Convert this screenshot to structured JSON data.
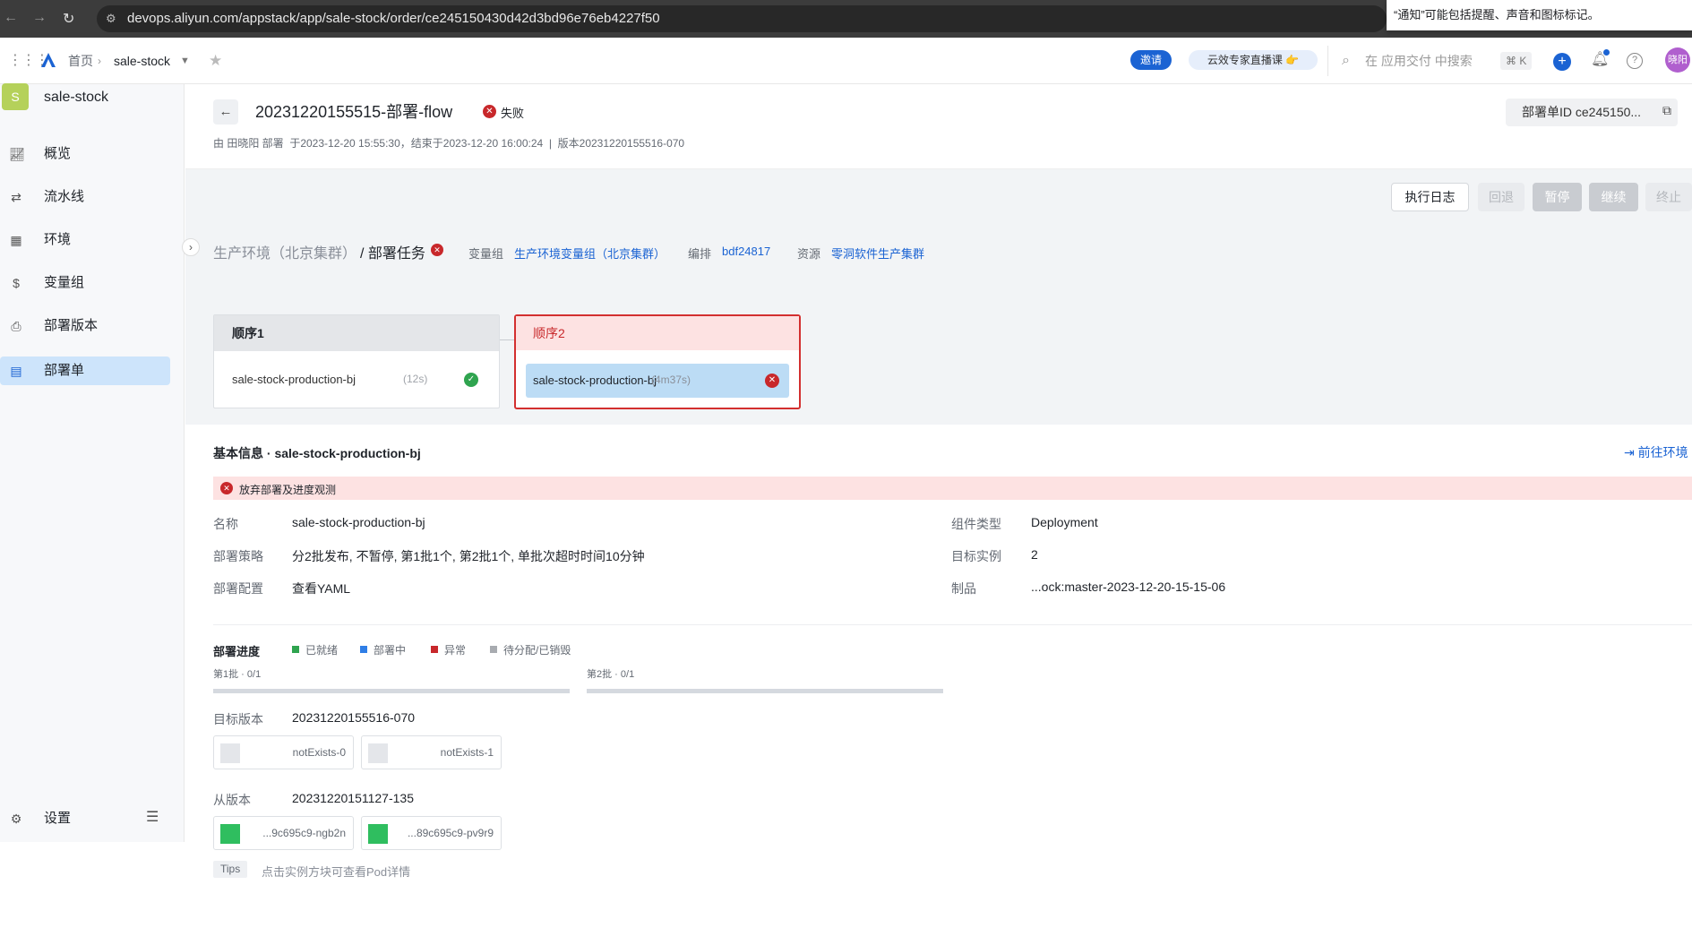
{
  "browser": {
    "url": "devops.aliyun.com/appstack/app/sale-stock/order/ce245150430d42d3bd96e76eb4227f50",
    "notification": "“通知”可能包括提醒、声音和图标标记。"
  },
  "topnav": {
    "home": "首页",
    "app": "sale-stock",
    "invite": "邀请",
    "live": "云效专家直播课 👉",
    "search_placeholder": "在 应用交付 中搜索",
    "shortcut": "⌘ K",
    "avatar": "晓阳"
  },
  "sidebar": {
    "app_initial": "S",
    "app_name": "sale-stock",
    "items": [
      {
        "label": "概览"
      },
      {
        "label": "流水线"
      },
      {
        "label": "环境"
      },
      {
        "label": "变量组"
      },
      {
        "label": "部署版本"
      },
      {
        "label": "部署单"
      }
    ],
    "settings": "设置"
  },
  "header": {
    "title": "20231220155515-部署-flow",
    "status": "失败",
    "meta": "由 田晓阳 部署  于2023-12-20 15:55:30，结束于2023-12-20 16:00:24  |  版本20231220155516-070",
    "order_id": "部署单ID ce245150..."
  },
  "stage": {
    "env": "生产环境（北京集群）",
    "task": "/ 部署任务",
    "var_label": "变量组",
    "var_value": "生产环境变量组（北京集群）",
    "arrange_label": "编排",
    "arrange_value": "bdf24817",
    "res_label": "资源",
    "res_value": "零洞软件生产集群",
    "buttons": {
      "log": "执行日志",
      "rollback": "回退",
      "pause": "暂停",
      "resume": "继续",
      "stop": "终止"
    },
    "order1": {
      "title": "顺序1",
      "task": "sale-stock-production-bj",
      "duration": "(12s)"
    },
    "order2": {
      "title": "顺序2",
      "task": "sale-stock-production-bj",
      "duration": "(4m37s)"
    }
  },
  "basic": {
    "title": "基本信息 · sale-stock-production-bj",
    "goto": "前往环境",
    "alert": "放弃部署及进度观测",
    "name_label": "名称",
    "name": "sale-stock-production-bj",
    "strategy_label": "部署策略",
    "strategy": "分2批发布, 不暂停, 第1批1个, 第2批1个, 单批次超时时间10分钟",
    "config_label": "部署配置",
    "config": "查看YAML",
    "type_label": "组件类型",
    "type": "Deployment",
    "instances_label": "目标实例",
    "instances": "2",
    "artifact_label": "制品",
    "artifact": "...ock:master-2023-12-20-15-15-06"
  },
  "progress": {
    "title": "部署进度",
    "legend": [
      {
        "label": "已就绪",
        "color": "#2fa44f"
      },
      {
        "label": "部署中",
        "color": "#2f7ee6"
      },
      {
        "label": "异常",
        "color": "#c8282b"
      },
      {
        "label": "待分配/已销毁",
        "color": "#a8abb0"
      }
    ],
    "batch1": "第1批 · 0/1",
    "batch2": "第2批 · 0/1",
    "batch1_fraction": 0,
    "batch2_fraction": 0,
    "target_label": "目标版本",
    "target_version": "20231220155516-070",
    "target_pods": [
      "notExists-0",
      "notExists-1"
    ],
    "from_label": "从版本",
    "from_version": "20231220151127-135",
    "from_pods": [
      "...9c695c9-ngb2n",
      "...89c695c9-pv9r9"
    ],
    "tips_tag": "Tips",
    "tips_text": "点击实例方块可查看Pod详情"
  }
}
